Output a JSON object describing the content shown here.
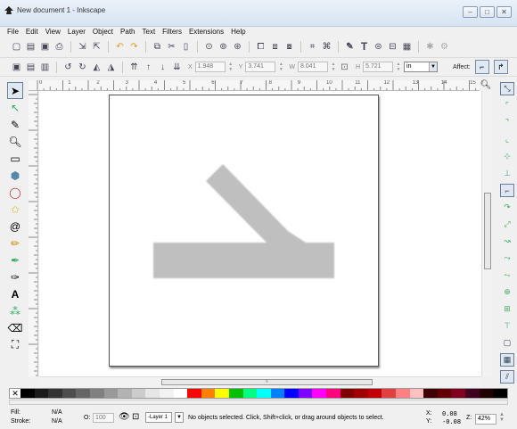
{
  "window": {
    "title": "New document 1 - Inkscape",
    "buttons": [
      "–",
      "□",
      "✕"
    ]
  },
  "menu": [
    "File",
    "Edit",
    "View",
    "Layer",
    "Object",
    "Path",
    "Text",
    "Filters",
    "Extensions",
    "Help"
  ],
  "toolbar": {
    "icons": [
      "new-icon",
      "open-icon",
      "save-icon",
      "print-icon",
      "import-icon",
      "export-icon",
      "undo-icon",
      "redo-icon",
      "copy-icon",
      "cut-icon",
      "paste-icon",
      "zoom-selection-icon",
      "zoom-drawing-icon",
      "zoom-page-icon",
      "duplicate-icon",
      "clone-icon",
      "unlink-clone-icon",
      "group-icon",
      "ungroup-icon",
      "fill-stroke-icon",
      "text-font-icon",
      "xml-editor-icon",
      "align-icon",
      "preferences-icon",
      "document-properties-icon"
    ]
  },
  "controls": {
    "x_label": "X",
    "x_value": "1.948",
    "y_label": "Y",
    "y_value": "3.741",
    "w_label": "W",
    "w_value": "8.041",
    "h_label": "H",
    "h_value": "5.721",
    "unit": "in",
    "affect_label": "Affect:"
  },
  "ruler": {
    "h_numbers": [
      "0",
      "1",
      "2",
      "3",
      "4",
      "5",
      "6",
      "7",
      "8",
      "9",
      "10",
      "11",
      "12",
      "13",
      "14",
      "15"
    ]
  },
  "tools": [
    "selector-icon",
    "node-icon",
    "tweak-icon",
    "zoom-icon",
    "rect-icon",
    "box3d-icon",
    "ellipse-icon",
    "star-icon",
    "spiral-icon",
    "pencil-icon",
    "pen-icon",
    "calligraphy-icon",
    "text-icon",
    "spray-icon",
    "eraser-icon",
    "bucket-icon"
  ],
  "palette": {
    "colors": [
      "#000000",
      "#1a1a1a",
      "#333333",
      "#4d4d4d",
      "#666666",
      "#808080",
      "#999999",
      "#b3b3b3",
      "#cccccc",
      "#e6e6e6",
      "#f2f2f2",
      "#ffffff",
      "#ff0000",
      "#ff8000",
      "#ffff00",
      "#00c000",
      "#00ff80",
      "#00ffff",
      "#0080ff",
      "#0000ff",
      "#8000ff",
      "#ff00ff",
      "#ff0080",
      "#800000",
      "#a00000",
      "#c00000",
      "#e04040",
      "#ff8080",
      "#ffc0c0",
      "#400000",
      "#600000",
      "#800020",
      "#400020",
      "#200000",
      "#000000"
    ]
  },
  "status": {
    "fill_label": "Fill:",
    "fill_value": "N/A",
    "stroke_label": "Stroke:",
    "stroke_value": "N/A",
    "opacity_label": "O:",
    "opacity_value": "100",
    "layer": "-Layer 1",
    "message": "No objects selected. Click, Shift+click, or drag around objects to select.",
    "x_label": "X:",
    "x_value": "0.08",
    "y_label": "Y:",
    "y_value": "-0.08",
    "zoom_label": "Z:",
    "zoom_value": "42%"
  }
}
